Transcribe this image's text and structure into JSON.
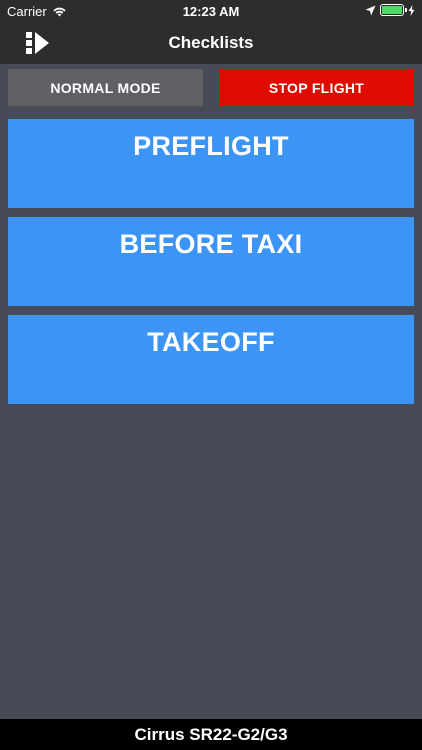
{
  "status_bar": {
    "carrier": "Carrier",
    "time": "12:23 AM",
    "battery_level": 1.0,
    "icons": [
      "wifi-icon",
      "location-arrow-icon",
      "battery-icon",
      "charging-bolt-icon"
    ]
  },
  "nav": {
    "title": "Checklists",
    "menu_icon": "sidebar-menu-icon"
  },
  "modes": {
    "normal_label": "NORMAL MODE",
    "stop_label": "STOP FLIGHT"
  },
  "checklists": [
    {
      "label": "PREFLIGHT"
    },
    {
      "label": "BEFORE TAXI"
    },
    {
      "label": "TAKEOFF"
    }
  ],
  "footer": {
    "aircraft": "Cirrus SR22-G2/G3"
  },
  "colors": {
    "background": "#474b55",
    "bar": "#2d2d2d",
    "checklist_blue": "#3c94f5",
    "stop_red": "#de0b00",
    "normal_gray": "#5f6064",
    "battery_green": "#4cd964"
  }
}
